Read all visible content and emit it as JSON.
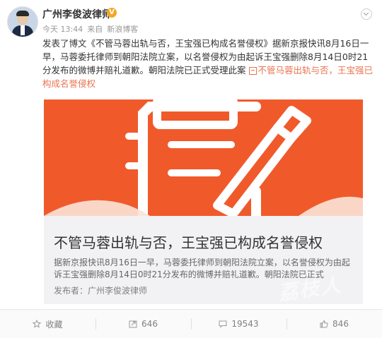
{
  "post": {
    "author": "广州李俊波律师",
    "verified_badge": "V",
    "time": "今天 13:44",
    "source_prefix": "来自",
    "source": "新浪博客",
    "text_prefix": "发表了博文",
    "text_title": "《不管马蓉出轨与否，王宝强已构成名誉侵权》",
    "text_body": "据新京报快讯8月16日一早，马蓉委托律师到朝阳法院立案，以名誉侵权为由起诉王宝强删除8月14日0时21分发布的微博并赔礼道歉。朝阳法院已正式受理此案",
    "text_link": "不管马蓉出轨与否，王宝强已构成名誉侵权"
  },
  "card": {
    "title": "不管马蓉出轨与否，王宝强已构成名誉侵权",
    "description": "据新京报快讯8月16日一早，马蓉委托律师到朝阳法院立案，以名誉侵权为由起诉王宝强删除8月14日0时21分发布的微博并赔礼道歉。朝阳法院已正式",
    "publisher": "发布者：广州李俊波律师",
    "image_color": "#f05a2b"
  },
  "footer": {
    "favorite_label": "收藏",
    "repost_count": "646",
    "comment_count": "19543",
    "like_count": "846"
  },
  "colors": {
    "accent": "#eb7350",
    "badge": "#f5a623"
  }
}
